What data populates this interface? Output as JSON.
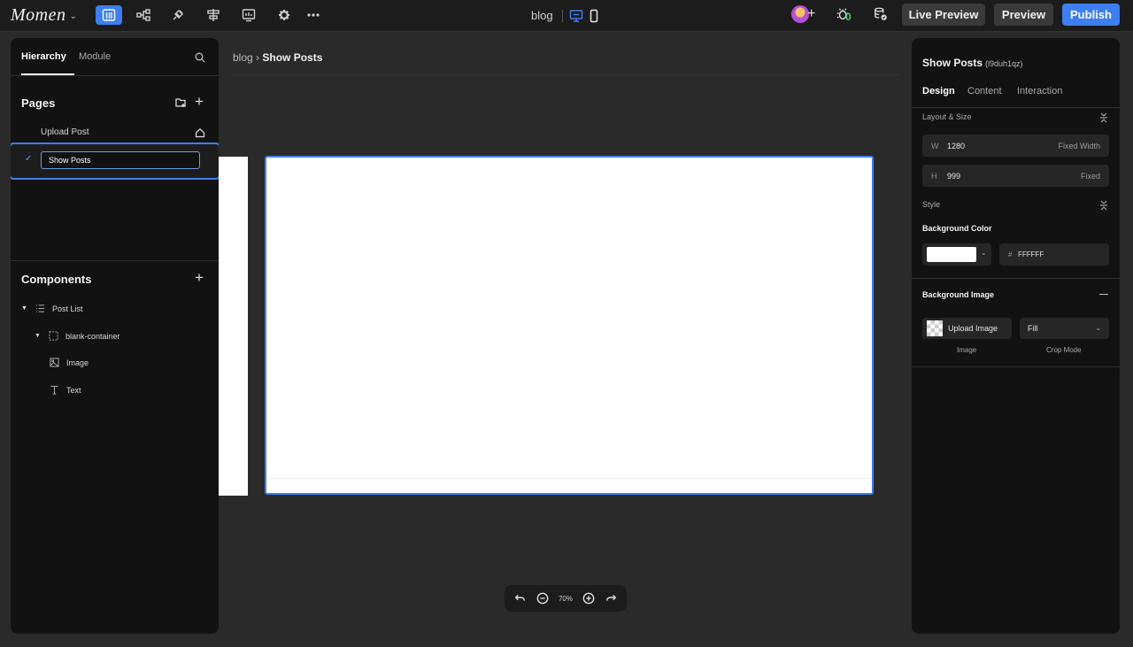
{
  "topbar": {
    "logo": "Momen",
    "project_name": "blog",
    "bug_count": "0",
    "live_preview_label": "Live Preview",
    "preview_label": "Preview",
    "publish_label": "Publish"
  },
  "left_panel": {
    "tabs": [
      {
        "label": "Hierarchy",
        "active": true
      },
      {
        "label": "Module",
        "active": false
      }
    ],
    "pages_title": "Pages",
    "pages": [
      {
        "label": "Upload Post",
        "home": true
      },
      {
        "label": "Show Posts",
        "selected": true,
        "editing": true
      }
    ],
    "components_title": "Components",
    "components": [
      {
        "label": "Post List",
        "icon": "list-icon",
        "level": 0,
        "expanded": true
      },
      {
        "label": "blank-container",
        "icon": "container-icon",
        "level": 1,
        "expanded": true
      },
      {
        "label": "Image",
        "icon": "image-icon",
        "level": 2
      },
      {
        "label": "Text",
        "icon": "text-icon",
        "level": 2
      }
    ]
  },
  "canvas": {
    "breadcrumb_root": "blog",
    "breadcrumb_sep": "›",
    "breadcrumb_current": "Show Posts",
    "zoom": "70%"
  },
  "right_panel": {
    "title": "Show Posts",
    "id": "(l9duh1qz)",
    "tabs": [
      {
        "label": "Design",
        "active": true
      },
      {
        "label": "Content",
        "active": false
      },
      {
        "label": "Interaction",
        "active": false
      }
    ],
    "layout_section": "Layout & Size",
    "width": {
      "label": "W",
      "value": "1280",
      "mode": "Fixed Width"
    },
    "height": {
      "label": "H",
      "value": "999",
      "mode": "Fixed"
    },
    "style_section": "Style",
    "bg_color_label": "Background Color",
    "bg_color_hash": "#",
    "bg_color_hex": "FFFFFF",
    "bg_image_label": "Background Image",
    "upload_image_label": "Upload Image",
    "crop_mode_value": "Fill",
    "image_caption": "Image",
    "crop_mode_caption": "Crop Mode"
  },
  "colors": {
    "accent": "#3d7ef0",
    "panel": "#121212",
    "background": "#2a2a2a"
  }
}
